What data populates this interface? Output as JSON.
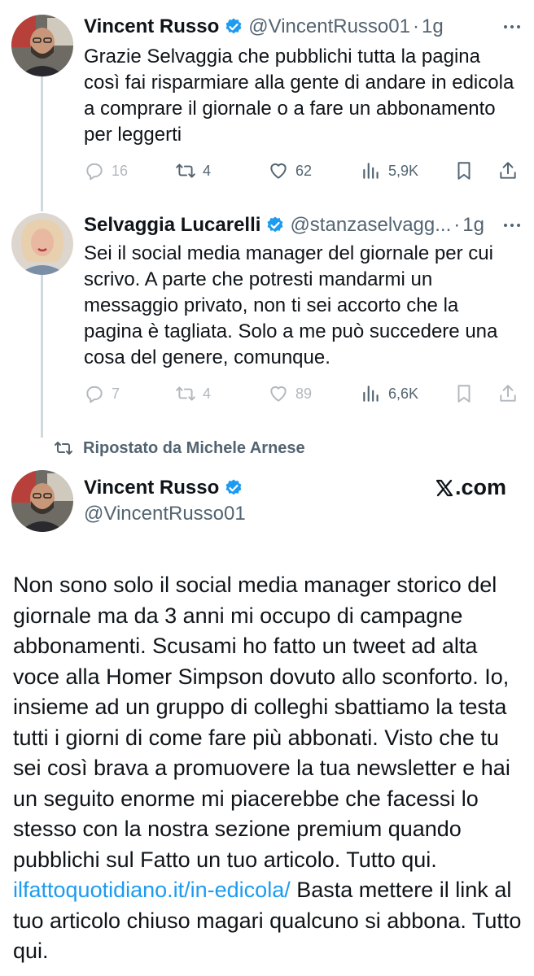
{
  "tweets": [
    {
      "name": "Vincent Russo",
      "handle": "@VincentRusso01",
      "time": "1g",
      "text": "Grazie Selvaggia che pubblichi tutta la pagina così fai risparmiare alla gente di andare in edicola a comprare il giornale o a fare un abbonamento per leggerti",
      "replies": "16",
      "reposts": "4",
      "likes": "62",
      "views": "5,9K"
    },
    {
      "name": "Selvaggia Lucarelli",
      "handle": "@stanzaselvagg...",
      "time": "1g",
      "text": "Sei il social media manager del giornale per cui scrivo. A parte che potresti mandarmi un messaggio privato, non ti sei accorto che la pagina è tagliata. Solo a me può succedere una cosa del genere, comunque.",
      "replies": "7",
      "reposts": "4",
      "likes": "89",
      "views": "6,6K"
    }
  ],
  "repost_label": "Ripostato da Michele Arnese",
  "source_badge": ".com",
  "main_tweet": {
    "name": "Vincent Russo",
    "handle": "@VincentRusso01",
    "text_before_link": "Non sono solo il social media manager storico del giornale ma da 3 anni mi occupo di campagne abbonamenti. Scusami ho fatto un tweet ad alta voce alla Homer Simpson dovuto allo sconforto. Io, insieme ad un gruppo di colleghi sbattiamo la testa tutti i giorni di come fare più abbonati. Visto che tu sei così brava a promuovere la tua newsletter e hai un seguito enorme mi piacerebbe che facessi lo stesso con la nostra sezione premium quando pubblichi sul Fatto un tuo articolo. Tutto qui. ",
    "link_text": "ilfattoquotidiano.it/in-edicola/",
    "text_after_link": " Basta mettere il link al tuo articolo chiuso magari qualcuno si abbona. Tutto qui."
  },
  "colors": {
    "text": "#0f1419",
    "secondary": "#536471",
    "verified": "#1d9bf0",
    "link": "#1d9bf0",
    "thread_line": "#cfd9de"
  },
  "icons": [
    "reply-icon",
    "repost-icon",
    "like-icon",
    "views-icon",
    "bookmark-icon",
    "share-icon",
    "more-icon",
    "verified-badge-icon",
    "x-logo-icon"
  ]
}
